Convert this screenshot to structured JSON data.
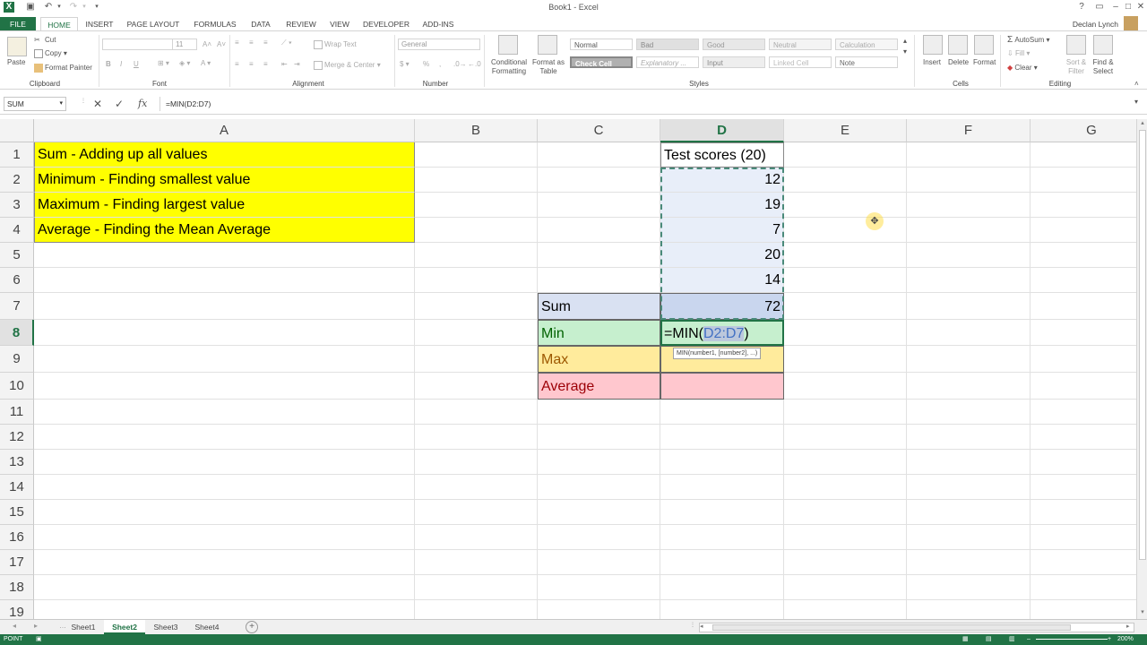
{
  "window": {
    "title": "Book1 - Excel",
    "user": "Declan Lynch"
  },
  "ribbon_tabs": [
    "FILE",
    "HOME",
    "INSERT",
    "PAGE LAYOUT",
    "FORMULAS",
    "DATA",
    "REVIEW",
    "VIEW",
    "DEVELOPER",
    "ADD-INS"
  ],
  "active_tab": "HOME",
  "clipboard": {
    "paste": "Paste",
    "cut": "Cut",
    "copy": "Copy",
    "format_painter": "Format Painter",
    "label": "Clipboard"
  },
  "font": {
    "size": "11",
    "bold": "B",
    "italic": "I",
    "underline": "U",
    "label": "Font"
  },
  "alignment": {
    "wrap_text": "Wrap Text",
    "merge_center": "Merge & Center",
    "label": "Alignment"
  },
  "number": {
    "format": "General",
    "percent": "%",
    "comma": ",",
    "label": "Number"
  },
  "styles": {
    "conditional_formatting": "Conditional Formatting",
    "format_as_table": "Format as Table",
    "cells": [
      {
        "label": "Normal",
        "bg": "#ffffff",
        "fg": "#555555"
      },
      {
        "label": "Bad",
        "bg": "#e0e0e0",
        "fg": "#888888"
      },
      {
        "label": "Good",
        "bg": "#e8e8e8",
        "fg": "#999999"
      },
      {
        "label": "Neutral",
        "bg": "#f4f4f4",
        "fg": "#aaaaaa"
      },
      {
        "label": "Calculation",
        "bg": "#f6f6f6",
        "fg": "#aaaaaa"
      },
      {
        "label": "Check Cell",
        "bg": "#b0b0b0",
        "fg": "#ffffff"
      },
      {
        "label": "Explanatory ...",
        "bg": "#ffffff",
        "fg": "#aaaaaa"
      },
      {
        "label": "Input",
        "bg": "#eeeeee",
        "fg": "#888888"
      },
      {
        "label": "Linked Cell",
        "bg": "#ffffff",
        "fg": "#bbbbbb"
      },
      {
        "label": "Note",
        "bg": "#ffffff",
        "fg": "#666666"
      }
    ],
    "label": "Styles"
  },
  "cells_group": {
    "insert": "Insert",
    "delete": "Delete",
    "format": "Format",
    "label": "Cells"
  },
  "editing": {
    "autosum": "AutoSum",
    "fill": "Fill",
    "clear": "Clear",
    "sort_filter": "Sort & Filter",
    "find_select": "Find & Select",
    "label": "Editing"
  },
  "formula_bar": {
    "name_box": "SUM",
    "cancel": "✕",
    "enter": "✓",
    "fx": "fx",
    "formula": "=MIN(D2:D7)"
  },
  "columns": [
    "A",
    "B",
    "C",
    "D",
    "E",
    "F",
    "G"
  ],
  "rows": [
    "1",
    "2",
    "3",
    "4",
    "5",
    "6",
    "7",
    "8",
    "9",
    "10",
    "11",
    "12",
    "13",
    "14",
    "15",
    "16",
    "17",
    "18",
    "19"
  ],
  "sheet": {
    "A1": "Sum - Adding up all values",
    "A2": "Minimum - Finding smallest value",
    "A3": "Maximum - Finding largest value",
    "A4": "Average - Finding the Mean Average",
    "D1": "Test scores (20)",
    "D2": "12",
    "D3": "19",
    "D4": "7",
    "D5": "20",
    "D6": "14",
    "C7": "Sum",
    "D7": "72",
    "C8": "Min",
    "D8_prefix": "=MIN(",
    "D8_ref": "D2:D7",
    "D8_suffix": ")",
    "C9": "Max",
    "C10": "Average",
    "tooltip": "MIN(number1, [number2], ...)"
  },
  "colors": {
    "yellow": "#ffff00",
    "sum_bg": "#d9e1f2",
    "min_bg": "#c6efce",
    "min_fg": "#006100",
    "max_bg": "#ffeb9c",
    "max_fg": "#9c5700",
    "avg_bg": "#ffc7ce",
    "avg_fg": "#9c0006",
    "range_bg": "#e8eef9",
    "excel_green": "#217346"
  },
  "sheet_tabs": [
    "Sheet1",
    "Sheet2",
    "Sheet3",
    "Sheet4"
  ],
  "active_sheet": "Sheet2",
  "status": {
    "mode": "POINT",
    "zoom": "200%"
  }
}
